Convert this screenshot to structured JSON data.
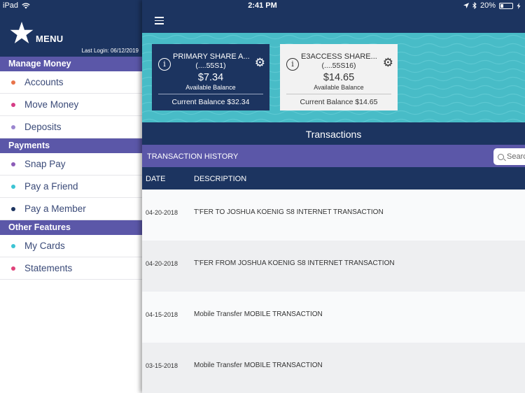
{
  "statusbar": {
    "device": "iPad",
    "time": "2:41 PM",
    "battery": "20%"
  },
  "sidebar": {
    "menu_label": "MENU",
    "last_login": "Last Login:  06/12/2019",
    "sections": [
      {
        "title": "Manage Money",
        "items": [
          {
            "label": "Accounts",
            "dot": "#e8734a"
          },
          {
            "label": "Move Money",
            "dot": "#d63d86"
          },
          {
            "label": "Deposits",
            "dot": "#9b86cf"
          }
        ]
      },
      {
        "title": "Payments",
        "items": [
          {
            "label": "Snap Pay",
            "dot": "#8c5cb8"
          },
          {
            "label": "Pay a Friend",
            "dot": "#3cc4d4"
          },
          {
            "label": "Pay a Member",
            "dot": "#1c3460"
          }
        ]
      },
      {
        "title": "Other Features",
        "items": [
          {
            "label": "My Cards",
            "dot": "#3cc4d4"
          },
          {
            "label": "Statements",
            "dot": "#e0427a"
          }
        ]
      }
    ]
  },
  "accounts": [
    {
      "name": "PRIMARY SHARE A...",
      "number": "(....55S1)",
      "balance": "$7.34",
      "available_label": "Available Balance",
      "current": "Current Balance $32.34"
    },
    {
      "name": "E3ACCESS SHARE...",
      "number": "(....55S16)",
      "balance": "$14.65",
      "available_label": "Available Balance",
      "current": "Current Balance $14.65"
    }
  ],
  "transactions": {
    "title": "Transactions",
    "history_label": "TRANSACTION HISTORY",
    "search_placeholder": "Search",
    "columns": {
      "date": "DATE",
      "description": "DESCRIPTION"
    },
    "rows": [
      {
        "date": "04-20-2018",
        "description": "T'FER TO JOSHUA KOENIG S8 INTERNET TRANSACTION"
      },
      {
        "date": "04-20-2018",
        "description": "T'FER FROM JOSHUA KOENIG S8 INTERNET TRANSACTION"
      },
      {
        "date": "04-15-2018",
        "description": "Mobile Transfer MOBILE TRANSACTION"
      },
      {
        "date": "03-15-2018",
        "description": "Mobile Transfer MOBILE TRANSACTION"
      }
    ]
  },
  "colors": {
    "navy": "#1c3460",
    "purple": "#5b57a8",
    "teal": "#48bcc7"
  }
}
